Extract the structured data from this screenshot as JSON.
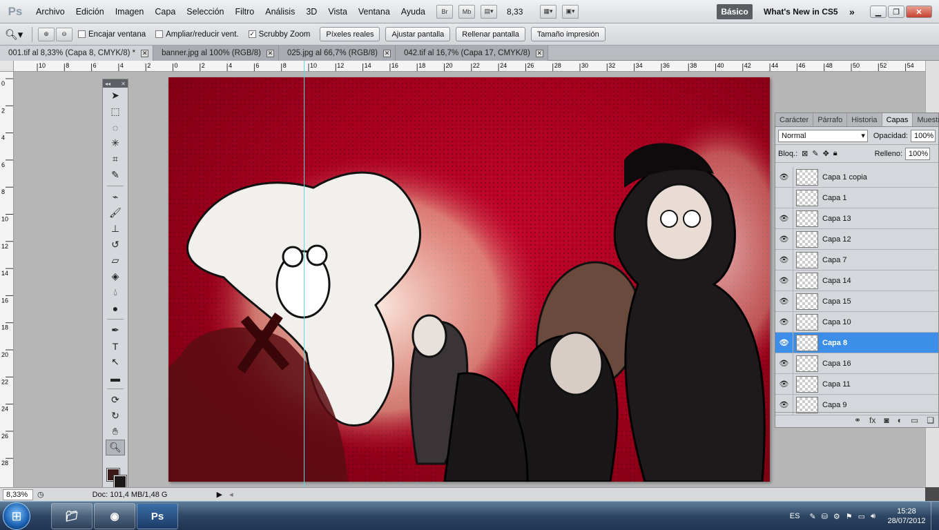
{
  "app": {
    "logo": "Ps"
  },
  "menu": [
    "Archivo",
    "Edición",
    "Imagen",
    "Capa",
    "Selección",
    "Filtro",
    "Análisis",
    "3D",
    "Vista",
    "Ventana",
    "Ayuda"
  ],
  "menubar_buttons": {
    "br": "Br",
    "mb": "Mb",
    "zoom": "8,33"
  },
  "workspace": {
    "active": "Básico",
    "whats_new": "What's New in CS5",
    "more": "»"
  },
  "options": {
    "checkboxes": [
      {
        "label": "Encajar ventana",
        "checked": false
      },
      {
        "label": "Ampliar/reducir vent.",
        "checked": false
      },
      {
        "label": "Scrubby Zoom",
        "checked": true
      }
    ],
    "buttons": [
      "Píxeles reales",
      "Ajustar pantalla",
      "Rellenar pantalla",
      "Tamaño impresión"
    ]
  },
  "doc_tabs": [
    {
      "label": "001.tif al 8,33% (Capa 8, CMYK/8) *",
      "active": true
    },
    {
      "label": "banner.jpg al 100% (RGB/8)",
      "active": false
    },
    {
      "label": "025.jpg al 66,7% (RGB/8)",
      "active": false
    },
    {
      "label": "042.tif al 16,7% (Capa 17, CMYK/8)",
      "active": false
    }
  ],
  "ruler_h": [
    "10",
    "8",
    "6",
    "4",
    "2",
    "0",
    "2",
    "4",
    "6",
    "8",
    "10",
    "12",
    "14",
    "16",
    "18",
    "20",
    "22",
    "24",
    "26",
    "28",
    "30",
    "32",
    "34",
    "36",
    "38",
    "40",
    "42",
    "44",
    "46",
    "48",
    "50",
    "52",
    "54"
  ],
  "ruler_v": [
    "0",
    "2",
    "4",
    "6",
    "8",
    "10",
    "12",
    "14",
    "16",
    "18",
    "20",
    "22",
    "24",
    "26",
    "28"
  ],
  "status": {
    "zoom": "8,33%",
    "doc": "Doc: 101,4 MB/1,48 G"
  },
  "panel": {
    "tabs": [
      "Carácter",
      "Párrafo",
      "Historia",
      "Capas",
      "Muestras"
    ],
    "active_tab": "Capas",
    "blend_mode": "Normal",
    "opacity_label": "Opacidad:",
    "opacity": "100%",
    "lock_label": "Bloq.:",
    "fill_label": "Relleno:",
    "fill": "100%",
    "layers": [
      {
        "name": "Capa 1 copia",
        "visible": true,
        "selected": false
      },
      {
        "name": "Capa 1",
        "visible": false,
        "selected": false
      },
      {
        "name": "Capa 13",
        "visible": true,
        "selected": false
      },
      {
        "name": "Capa 12",
        "visible": true,
        "selected": false
      },
      {
        "name": "Capa 7",
        "visible": true,
        "selected": false
      },
      {
        "name": "Capa 14",
        "visible": true,
        "selected": false
      },
      {
        "name": "Capa 15",
        "visible": true,
        "selected": false
      },
      {
        "name": "Capa 10",
        "visible": true,
        "selected": false
      },
      {
        "name": "Capa 8",
        "visible": true,
        "selected": true
      },
      {
        "name": "Capa 16",
        "visible": true,
        "selected": false
      },
      {
        "name": "Capa 11",
        "visible": true,
        "selected": false
      },
      {
        "name": "Capa 9",
        "visible": true,
        "selected": false
      }
    ]
  },
  "taskbar": {
    "lang": "ES",
    "time": "15:28",
    "date": "28/07/2012",
    "ps_label": "Ps"
  },
  "colors": {
    "foreground": "#3a1a16",
    "background": "#1c1818",
    "selected_layer": "#3d8ee8",
    "canvas_red": "#a8001f"
  }
}
